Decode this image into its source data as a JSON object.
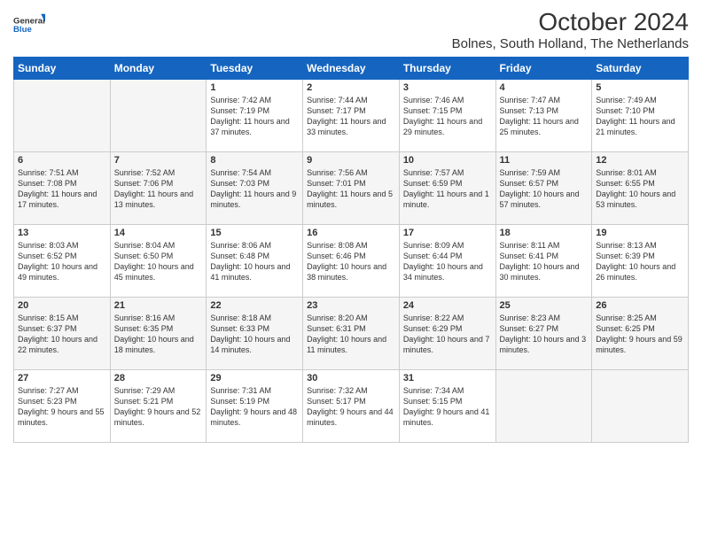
{
  "logo": {
    "general": "General",
    "blue": "Blue"
  },
  "title": "October 2024",
  "subtitle": "Bolnes, South Holland, The Netherlands",
  "headers": [
    "Sunday",
    "Monday",
    "Tuesday",
    "Wednesday",
    "Thursday",
    "Friday",
    "Saturday"
  ],
  "weeks": [
    [
      {
        "day": "",
        "sunrise": "",
        "sunset": "",
        "daylight": ""
      },
      {
        "day": "",
        "sunrise": "",
        "sunset": "",
        "daylight": ""
      },
      {
        "day": "1",
        "sunrise": "Sunrise: 7:42 AM",
        "sunset": "Sunset: 7:19 PM",
        "daylight": "Daylight: 11 hours and 37 minutes."
      },
      {
        "day": "2",
        "sunrise": "Sunrise: 7:44 AM",
        "sunset": "Sunset: 7:17 PM",
        "daylight": "Daylight: 11 hours and 33 minutes."
      },
      {
        "day": "3",
        "sunrise": "Sunrise: 7:46 AM",
        "sunset": "Sunset: 7:15 PM",
        "daylight": "Daylight: 11 hours and 29 minutes."
      },
      {
        "day": "4",
        "sunrise": "Sunrise: 7:47 AM",
        "sunset": "Sunset: 7:13 PM",
        "daylight": "Daylight: 11 hours and 25 minutes."
      },
      {
        "day": "5",
        "sunrise": "Sunrise: 7:49 AM",
        "sunset": "Sunset: 7:10 PM",
        "daylight": "Daylight: 11 hours and 21 minutes."
      }
    ],
    [
      {
        "day": "6",
        "sunrise": "Sunrise: 7:51 AM",
        "sunset": "Sunset: 7:08 PM",
        "daylight": "Daylight: 11 hours and 17 minutes."
      },
      {
        "day": "7",
        "sunrise": "Sunrise: 7:52 AM",
        "sunset": "Sunset: 7:06 PM",
        "daylight": "Daylight: 11 hours and 13 minutes."
      },
      {
        "day": "8",
        "sunrise": "Sunrise: 7:54 AM",
        "sunset": "Sunset: 7:03 PM",
        "daylight": "Daylight: 11 hours and 9 minutes."
      },
      {
        "day": "9",
        "sunrise": "Sunrise: 7:56 AM",
        "sunset": "Sunset: 7:01 PM",
        "daylight": "Daylight: 11 hours and 5 minutes."
      },
      {
        "day": "10",
        "sunrise": "Sunrise: 7:57 AM",
        "sunset": "Sunset: 6:59 PM",
        "daylight": "Daylight: 11 hours and 1 minute."
      },
      {
        "day": "11",
        "sunrise": "Sunrise: 7:59 AM",
        "sunset": "Sunset: 6:57 PM",
        "daylight": "Daylight: 10 hours and 57 minutes."
      },
      {
        "day": "12",
        "sunrise": "Sunrise: 8:01 AM",
        "sunset": "Sunset: 6:55 PM",
        "daylight": "Daylight: 10 hours and 53 minutes."
      }
    ],
    [
      {
        "day": "13",
        "sunrise": "Sunrise: 8:03 AM",
        "sunset": "Sunset: 6:52 PM",
        "daylight": "Daylight: 10 hours and 49 minutes."
      },
      {
        "day": "14",
        "sunrise": "Sunrise: 8:04 AM",
        "sunset": "Sunset: 6:50 PM",
        "daylight": "Daylight: 10 hours and 45 minutes."
      },
      {
        "day": "15",
        "sunrise": "Sunrise: 8:06 AM",
        "sunset": "Sunset: 6:48 PM",
        "daylight": "Daylight: 10 hours and 41 minutes."
      },
      {
        "day": "16",
        "sunrise": "Sunrise: 8:08 AM",
        "sunset": "Sunset: 6:46 PM",
        "daylight": "Daylight: 10 hours and 38 minutes."
      },
      {
        "day": "17",
        "sunrise": "Sunrise: 8:09 AM",
        "sunset": "Sunset: 6:44 PM",
        "daylight": "Daylight: 10 hours and 34 minutes."
      },
      {
        "day": "18",
        "sunrise": "Sunrise: 8:11 AM",
        "sunset": "Sunset: 6:41 PM",
        "daylight": "Daylight: 10 hours and 30 minutes."
      },
      {
        "day": "19",
        "sunrise": "Sunrise: 8:13 AM",
        "sunset": "Sunset: 6:39 PM",
        "daylight": "Daylight: 10 hours and 26 minutes."
      }
    ],
    [
      {
        "day": "20",
        "sunrise": "Sunrise: 8:15 AM",
        "sunset": "Sunset: 6:37 PM",
        "daylight": "Daylight: 10 hours and 22 minutes."
      },
      {
        "day": "21",
        "sunrise": "Sunrise: 8:16 AM",
        "sunset": "Sunset: 6:35 PM",
        "daylight": "Daylight: 10 hours and 18 minutes."
      },
      {
        "day": "22",
        "sunrise": "Sunrise: 8:18 AM",
        "sunset": "Sunset: 6:33 PM",
        "daylight": "Daylight: 10 hours and 14 minutes."
      },
      {
        "day": "23",
        "sunrise": "Sunrise: 8:20 AM",
        "sunset": "Sunset: 6:31 PM",
        "daylight": "Daylight: 10 hours and 11 minutes."
      },
      {
        "day": "24",
        "sunrise": "Sunrise: 8:22 AM",
        "sunset": "Sunset: 6:29 PM",
        "daylight": "Daylight: 10 hours and 7 minutes."
      },
      {
        "day": "25",
        "sunrise": "Sunrise: 8:23 AM",
        "sunset": "Sunset: 6:27 PM",
        "daylight": "Daylight: 10 hours and 3 minutes."
      },
      {
        "day": "26",
        "sunrise": "Sunrise: 8:25 AM",
        "sunset": "Sunset: 6:25 PM",
        "daylight": "Daylight: 9 hours and 59 minutes."
      }
    ],
    [
      {
        "day": "27",
        "sunrise": "Sunrise: 7:27 AM",
        "sunset": "Sunset: 5:23 PM",
        "daylight": "Daylight: 9 hours and 55 minutes."
      },
      {
        "day": "28",
        "sunrise": "Sunrise: 7:29 AM",
        "sunset": "Sunset: 5:21 PM",
        "daylight": "Daylight: 9 hours and 52 minutes."
      },
      {
        "day": "29",
        "sunrise": "Sunrise: 7:31 AM",
        "sunset": "Sunset: 5:19 PM",
        "daylight": "Daylight: 9 hours and 48 minutes."
      },
      {
        "day": "30",
        "sunrise": "Sunrise: 7:32 AM",
        "sunset": "Sunset: 5:17 PM",
        "daylight": "Daylight: 9 hours and 44 minutes."
      },
      {
        "day": "31",
        "sunrise": "Sunrise: 7:34 AM",
        "sunset": "Sunset: 5:15 PM",
        "daylight": "Daylight: 9 hours and 41 minutes."
      },
      {
        "day": "",
        "sunrise": "",
        "sunset": "",
        "daylight": ""
      },
      {
        "day": "",
        "sunrise": "",
        "sunset": "",
        "daylight": ""
      }
    ]
  ]
}
